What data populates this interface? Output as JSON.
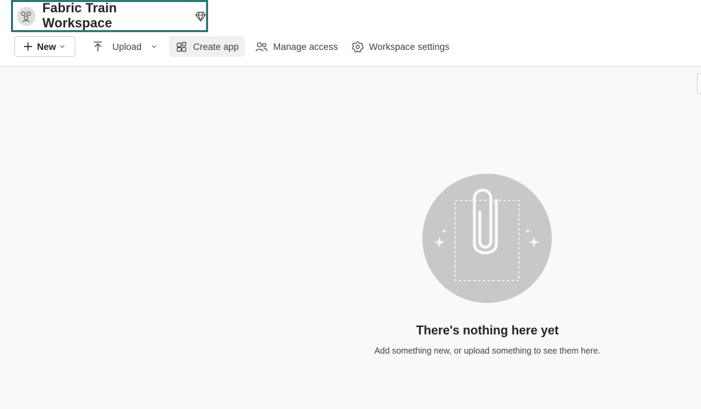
{
  "workspace": {
    "title": "Fabric Train Workspace",
    "avatar_icon": "workspace-people-icon",
    "premium_icon": "diamond-icon"
  },
  "toolbar": {
    "new_label": "New",
    "upload_label": "Upload",
    "create_app_label": "Create app",
    "manage_access_label": "Manage access",
    "workspace_settings_label": "Workspace settings"
  },
  "empty_state": {
    "icon": "paperclip-icon",
    "title": "There's nothing here yet",
    "subtitle": "Add something new, or upload something to see them here."
  },
  "colors": {
    "highlight_border": "#2b7a78",
    "page_background": "#faf9f8",
    "illustration_circle": "#c8c8c8"
  }
}
